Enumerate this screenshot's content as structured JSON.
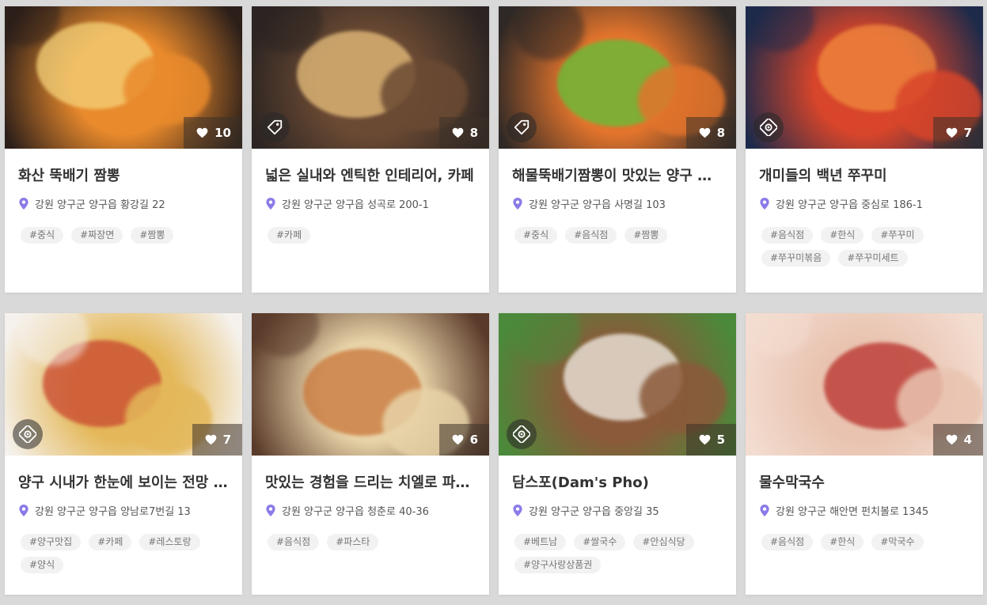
{
  "cards": [
    {
      "title": "화산 뚝배기 짬뽕",
      "address": "강원 양구군 양구읍 황강길 22",
      "likes": "10",
      "tags": [
        "#중식",
        "#짜장면",
        "#짬뽕"
      ],
      "badge": "none",
      "photo_colors": [
        "#e98a2c",
        "#f4d27a",
        "#2c1f1a"
      ]
    },
    {
      "title": "넓은 실내와 엔틱한 인테리어, 카페",
      "address": "강원 양구군 양구읍 성곡로 200-1",
      "likes": "8",
      "tags": [
        "#카페"
      ],
      "badge": "tag-icon",
      "photo_colors": [
        "#6b4a33",
        "#e9c07d",
        "#2b2422"
      ]
    },
    {
      "title": "해물뚝배기짬뽕이 맛있는 양구 중식당",
      "address": "강원 양구군 양구읍 사명길 103",
      "likes": "8",
      "tags": [
        "#중식",
        "#음식점",
        "#짬뽕"
      ],
      "badge": "tag-icon",
      "photo_colors": [
        "#e2742c",
        "#5fc13a",
        "#2e2826"
      ]
    },
    {
      "title": "개미들의 백년 쭈꾸미",
      "address": "강원 양구군 양구읍 중심로 186-1",
      "likes": "7",
      "tags": [
        "#음식점",
        "#한식",
        "#쭈꾸미",
        "#쭈꾸미볶음",
        "#쭈꾸미세트"
      ],
      "badge": "coupon-icon",
      "photo_colors": [
        "#d8452a",
        "#f08a3e",
        "#1d2a4a"
      ]
    },
    {
      "title": "양구 시내가 한눈에 보이는 전망 좋은 레스토랑",
      "address": "강원 양구군 양구읍 양남로7번길 13",
      "likes": "7",
      "tags": [
        "#양구맛집",
        "#카페",
        "#레스토랑",
        "#양식"
      ],
      "badge": "coupon-icon",
      "photo_colors": [
        "#e4b85a",
        "#c9462f",
        "#f5f1ec"
      ]
    },
    {
      "title": "맛있는 경험을 드리는 치엘로 파스타",
      "address": "강원 양구군 양구읍 청춘로 40-36",
      "likes": "6",
      "tags": [
        "#음식점",
        "#파스타"
      ],
      "badge": "none",
      "photo_colors": [
        "#e8d3a8",
        "#c9763a",
        "#5a3a2a"
      ]
    },
    {
      "title": "담스포(Dam's Pho)",
      "address": "강원 양구군 양구읍 중앙길 35",
      "likes": "5",
      "tags": [
        "#베트남",
        "#쌀국수",
        "#안심식당",
        "#양구사랑상품권"
      ],
      "badge": "coupon-icon",
      "photo_colors": [
        "#8a5a3a",
        "#f3efe6",
        "#4a8a3a"
      ]
    },
    {
      "title": "물수막국수",
      "address": "강원 양구군 해안면 펀치볼로 1345",
      "likes": "4",
      "tags": [
        "#음식점",
        "#한식",
        "#막국수"
      ],
      "badge": "none",
      "photo_colors": [
        "#e9c3b0",
        "#b8302a",
        "#f3ddd1"
      ]
    }
  ]
}
